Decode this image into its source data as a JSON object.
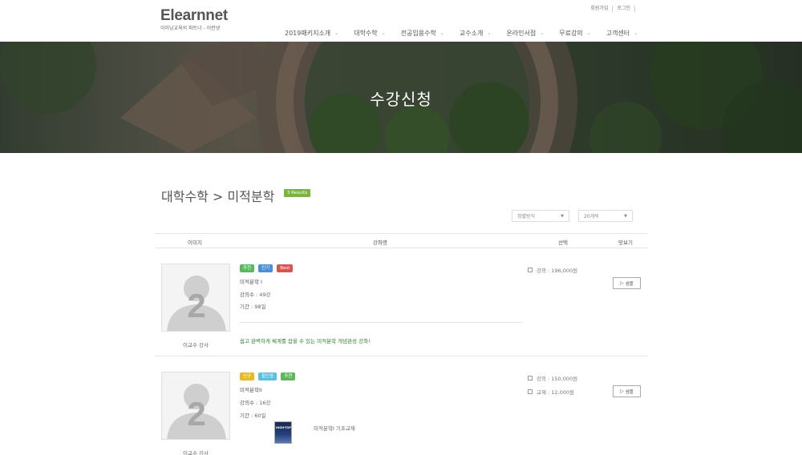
{
  "header": {
    "logo": "Elearnnet",
    "logo_sub": "이러닝교육의 파트너 - 이런넷",
    "util": {
      "join": "회원가입",
      "login": "로그인"
    },
    "nav": [
      "2019패키지소개",
      "대학수학",
      "전공임용수학",
      "교수소개",
      "온라인서점",
      "무료강의",
      "고객센터"
    ]
  },
  "hero": {
    "title": "수강신청"
  },
  "main": {
    "title": "대학수학 > 미적분학",
    "results": "3 Results",
    "sort_select": "정렬방식",
    "count_select": "20개씩"
  },
  "table": {
    "headers": {
      "image": "이미지",
      "course": "강좌명",
      "select": "선택",
      "preview": "맛보기"
    }
  },
  "courses": [
    {
      "tags": [
        {
          "label": "추천",
          "color": "#5cb85c"
        },
        {
          "label": "인기",
          "color": "#4a90d9"
        },
        {
          "label": "Best",
          "color": "#d9534f"
        }
      ],
      "title": "미적분학 I",
      "lectures_label": "강의수 : ",
      "lectures": "49강",
      "period_label": "기간 : ",
      "period": "98일",
      "description": "쉽고 완벽하게 체계를 잡을 수 있는 미적분학 개념완성 강좌!",
      "teacher": "이교수 강사",
      "prices": [
        "강의 : 196,000원"
      ],
      "sample": "샘플",
      "thumb_number": "2"
    },
    {
      "tags": [
        {
          "label": "신규",
          "color": "#e8b923"
        },
        {
          "label": "할인중",
          "color": "#5bc0de"
        },
        {
          "label": "추천",
          "color": "#5cb85c"
        }
      ],
      "title": "미적분학II",
      "lectures_label": "강의수 : ",
      "lectures": "16강",
      "period_label": "기간 : ",
      "period": "60일",
      "book_name": "미적분학I 기초교재",
      "book_cover": "HIGH-TOP",
      "teacher": "이교수 강사",
      "prices": [
        "강의 : 150,000원",
        "교재 : 12,000원"
      ],
      "sample": "샘플",
      "thumb_number": "2"
    }
  ]
}
